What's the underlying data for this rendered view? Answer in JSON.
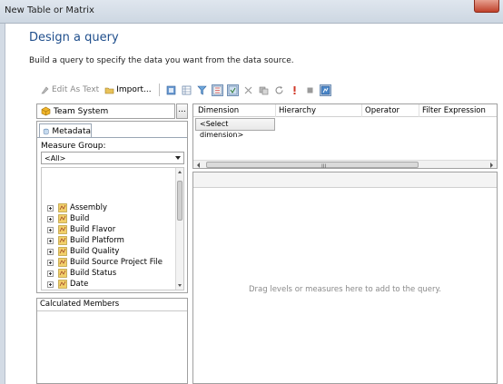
{
  "window": {
    "title": "New Table or Matrix"
  },
  "page": {
    "heading": "Design a query",
    "description": "Build a query to specify the data you want from the data source."
  },
  "toolbar": {
    "edit_as_text": "Edit As Text",
    "import": "Import..."
  },
  "cube": {
    "name": "Team System",
    "browse_label": "..."
  },
  "metadata": {
    "tab_label": "Metadata",
    "measure_group_label": "Measure Group:",
    "measure_group_value": "<All>",
    "tree_items": [
      {
        "label": "Assembly"
      },
      {
        "label": "Build"
      },
      {
        "label": "Build Flavor"
      },
      {
        "label": "Build Platform"
      },
      {
        "label": "Build Quality"
      },
      {
        "label": "Build Source Project File"
      },
      {
        "label": "Build Status"
      },
      {
        "label": "Date"
      }
    ]
  },
  "calculated_members": {
    "label": "Calculated Members"
  },
  "filter_grid": {
    "columns": [
      "Dimension",
      "Hierarchy",
      "Operator",
      "Filter Expression"
    ],
    "placeholder_row": "<Select dimension>",
    "scroll_grip": "III"
  },
  "results": {
    "hint": "Drag levels or measures here to add to the query."
  },
  "colors": {
    "heading": "#1f4e8c",
    "hint": "#8a8a8a"
  }
}
